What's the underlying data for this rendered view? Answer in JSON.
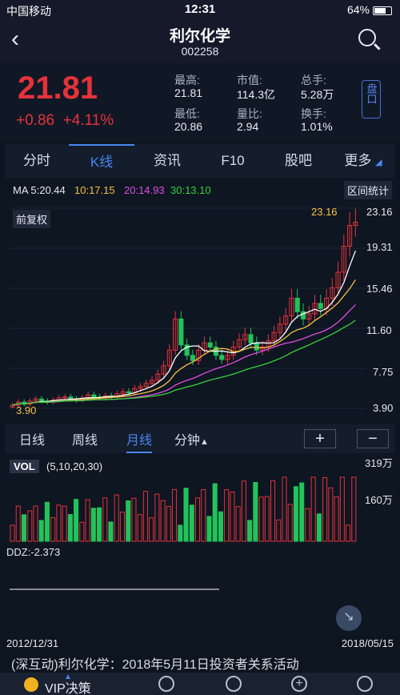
{
  "status": {
    "carrier": "中国移动",
    "time": "12:31",
    "battery": "64%"
  },
  "nav": {
    "title": "利尔化学",
    "code": "002258"
  },
  "quote": {
    "price": "21.81",
    "change": "+0.86",
    "change_pct": "+4.11%",
    "stats": [
      {
        "k": "最高:",
        "v": "21.81"
      },
      {
        "k": "市值:",
        "v": "114.3亿"
      },
      {
        "k": "总手:",
        "v": "5.28万"
      },
      {
        "k": "最低:",
        "v": "20.86"
      },
      {
        "k": "量比:",
        "v": "2.94"
      },
      {
        "k": "换手:",
        "v": "1.01%"
      }
    ],
    "pan_label": "盘口"
  },
  "tabs": [
    "分时",
    "K线",
    "资讯",
    "F10",
    "股吧",
    "更多"
  ],
  "ma": {
    "ma5": "MA 5:20.44",
    "ma10": "10:17.15",
    "ma20": "20:14.93",
    "ma30": "30:13.10"
  },
  "buttons": {
    "range_stats": "区间统计",
    "adjust": "前复权"
  },
  "price_axis": [
    "23.16",
    "19.31",
    "15.46",
    "11.60",
    "7.75",
    "3.90"
  ],
  "marks": {
    "high": "23.16",
    "low": "3.90"
  },
  "periods": {
    "day": "日线",
    "week": "周线",
    "month": "月线",
    "minute": "分钟",
    "zoom_in": "+",
    "zoom_out": "−"
  },
  "vol": {
    "label": "VOL",
    "params": "(5,10,20,30)",
    "max": "319万",
    "mid": "160万"
  },
  "ddz": {
    "label": "DDZ:-2.373"
  },
  "dates": {
    "start": "2012/12/31",
    "end": "2018/05/15"
  },
  "news": "(深互动)利尔化学：2018年5月11日投资者关系活动",
  "bottom": {
    "vip": "VIP决策"
  },
  "colors": {
    "up": "#e5323a",
    "down": "#22c35a",
    "ma5": "#ffffff",
    "ma10": "#f5c242",
    "ma20": "#e04de0",
    "ma30": "#3ad13a",
    "accent": "#4a86f0"
  },
  "chart_data": [
    {
      "type": "candlestick",
      "title": "利尔化学 月K",
      "x_range": [
        "2012/12/31",
        "2018/05/15"
      ],
      "ylim": [
        3.9,
        23.16
      ],
      "close": [
        4.2,
        4.5,
        4.3,
        4.6,
        4.8,
        4.6,
        4.5,
        4.7,
        4.9,
        5.0,
        4.8,
        4.7,
        4.9,
        5.2,
        5.0,
        4.9,
        5.1,
        5.0,
        5.3,
        5.5,
        5.4,
        5.8,
        6.0,
        6.3,
        6.6,
        7.2,
        8.0,
        9.5,
        12.5,
        10.0,
        9.0,
        8.5,
        9.5,
        10.2,
        9.8,
        9.0,
        8.6,
        9.0,
        9.8,
        10.5,
        11.0,
        10.2,
        9.5,
        9.8,
        10.4,
        11.2,
        12.0,
        12.8,
        14.5,
        13.2,
        12.5,
        13.0,
        14.0,
        13.5,
        14.5,
        15.5,
        17.0,
        19.5,
        21.5,
        21.81
      ],
      "high": 23.16,
      "low": 3.9
    },
    {
      "type": "bar",
      "title": "VOL",
      "ylim": [
        0,
        319
      ],
      "unit": "万"
    }
  ]
}
